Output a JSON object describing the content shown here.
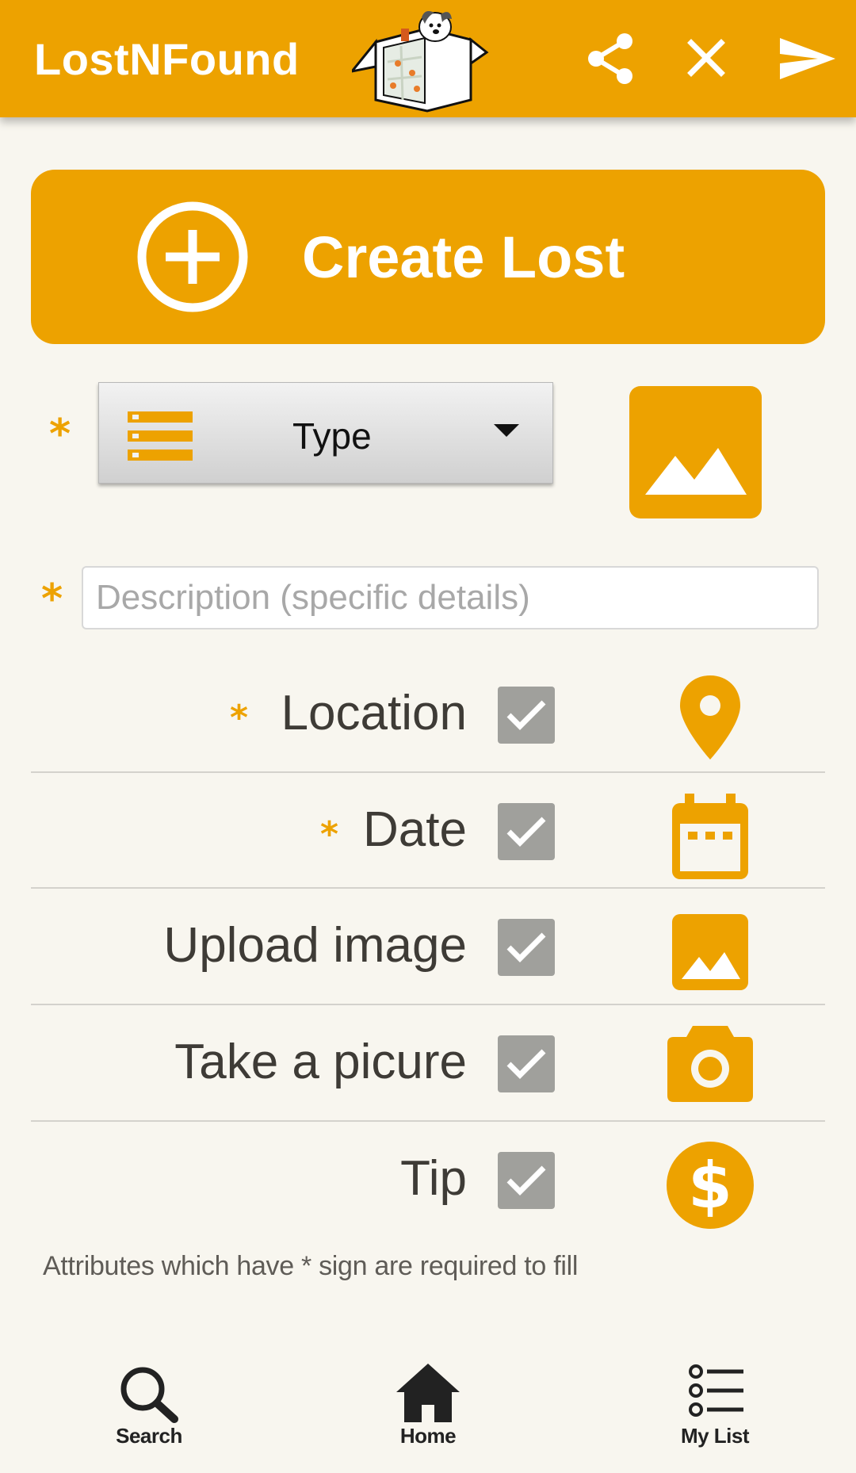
{
  "app": {
    "title": "LostNFound",
    "brand_color": "#eda200",
    "background_color": "#f8f6ef"
  },
  "header_actions": [
    {
      "name": "share-icon"
    },
    {
      "name": "close-icon"
    },
    {
      "name": "send-icon"
    }
  ],
  "create_button": {
    "label": "Create Lost",
    "icon": "add-circle-icon"
  },
  "form": {
    "required_marker": "*",
    "type_select": {
      "selected": "Type",
      "icon": "list-icon"
    },
    "image_button_icon": "image-icon",
    "description": {
      "value": "",
      "placeholder": "Description (specific details)"
    },
    "attributes": [
      {
        "label": "Location",
        "required": true,
        "checked": true,
        "icon": "location-pin-icon"
      },
      {
        "label": "Date",
        "required": true,
        "checked": true,
        "icon": "calendar-icon"
      },
      {
        "label": "Upload image",
        "required": false,
        "checked": true,
        "icon": "image-icon"
      },
      {
        "label": "Take a picure",
        "required": false,
        "checked": true,
        "icon": "camera-icon"
      },
      {
        "label": "Tip",
        "required": false,
        "checked": true,
        "icon": "dollar-icon"
      }
    ],
    "hint": "Attributes which have * sign are required to fill"
  },
  "bottom_nav": [
    {
      "label": "Search",
      "icon": "search-icon"
    },
    {
      "label": "Home",
      "icon": "home-icon"
    },
    {
      "label": "My List",
      "icon": "list-icon"
    }
  ]
}
